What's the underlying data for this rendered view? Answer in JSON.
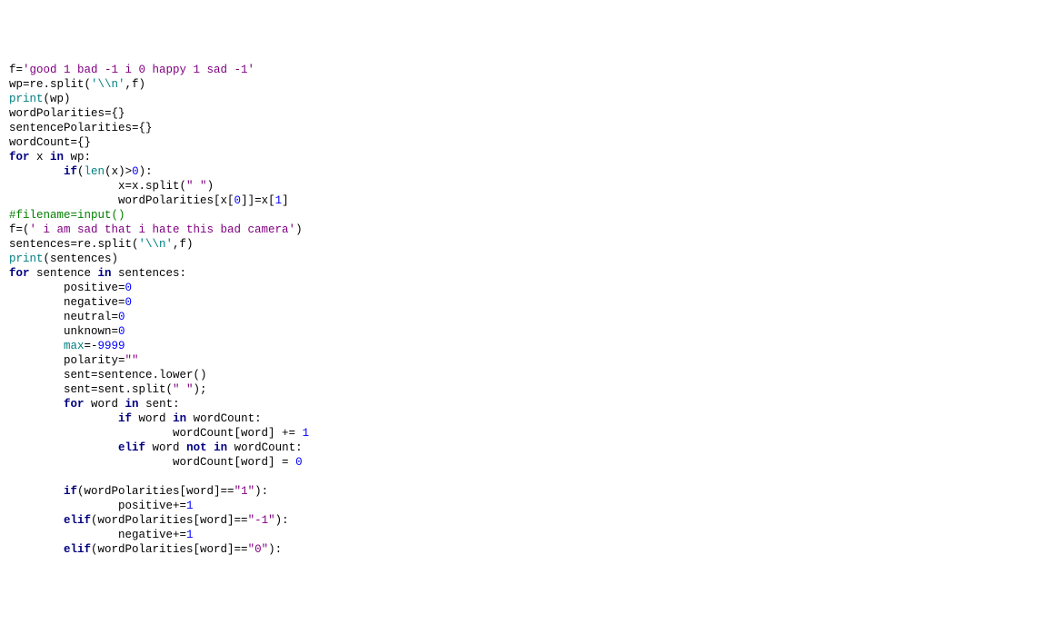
{
  "code": {
    "line1_a": "f=",
    "line1_b": "'good 1 bad -1 i 0 happy 1 sad -1'",
    "line2_a": "wp=re.split(",
    "line2_b": "'\\\\n'",
    "line2_c": ",f)",
    "line3_a": "print",
    "line3_b": "(wp)",
    "line4": "wordPolarities={}",
    "line5": "sentencePolarities={}",
    "line6": "wordCount={}",
    "line7_a": "for",
    "line7_b": " x ",
    "line7_c": "in",
    "line7_d": " wp:",
    "line8_a": "        ",
    "line8_b": "if",
    "line8_c": "(",
    "line8_d": "len",
    "line8_e": "(x)>",
    "line8_f": "0",
    "line8_g": "):",
    "line9_a": "                x=x.split(",
    "line9_b": "\" \"",
    "line9_c": ")",
    "line10_a": "                wordPolarities[x[",
    "line10_b": "0",
    "line10_c": "]]=x[",
    "line10_d": "1",
    "line10_e": "]",
    "line11": "#filename=input()",
    "line12_a": "f=(",
    "line12_b": "' i am sad that i hate this bad camera'",
    "line12_c": ")",
    "line13_a": "sentences=re.split(",
    "line13_b": "'\\\\n'",
    "line13_c": ",f)",
    "line14_a": "print",
    "line14_b": "(sentences)",
    "line15_a": "for",
    "line15_b": " sentence ",
    "line15_c": "in",
    "line15_d": " sentences:",
    "line16_a": "        positive=",
    "line16_b": "0",
    "line17_a": "        negative=",
    "line17_b": "0",
    "line18_a": "        neutral=",
    "line18_b": "0",
    "line19_a": "        unknown=",
    "line19_b": "0",
    "line20_a": "        ",
    "line20_b": "max",
    "line20_c": "=-",
    "line20_d": "9999",
    "line21_a": "        polarity=",
    "line21_b": "\"\"",
    "line22": "        sent=sentence.lower()",
    "line23_a": "        sent=sent.split(",
    "line23_b": "\" \"",
    "line23_c": ");",
    "line24_a": "        ",
    "line24_b": "for",
    "line24_c": " word ",
    "line24_d": "in",
    "line24_e": " sent:",
    "line25_a": "                ",
    "line25_b": "if",
    "line25_c": " word ",
    "line25_d": "in",
    "line25_e": " wordCount:",
    "line26_a": "                        wordCount[word] += ",
    "line26_b": "1",
    "line27_a": "                ",
    "line27_b": "elif",
    "line27_c": " word ",
    "line27_d": "not",
    "line27_e": " ",
    "line27_f": "in",
    "line27_g": " wordCount:",
    "line28_a": "                        wordCount[word] = ",
    "line28_b": "0",
    "line29": "",
    "line30_a": "        ",
    "line30_b": "if",
    "line30_c": "(wordPolarities[word]==",
    "line30_d": "\"1\"",
    "line30_e": "):",
    "line31_a": "                positive+=",
    "line31_b": "1",
    "line32_a": "        ",
    "line32_b": "elif",
    "line32_c": "(wordPolarities[word]==",
    "line32_d": "\"-1\"",
    "line32_e": "):",
    "line33_a": "                negative+=",
    "line33_b": "1",
    "line34_a": "        ",
    "line34_b": "elif",
    "line34_c": "(wordPolarities[word]==",
    "line34_d": "\"0\"",
    "line34_e": "):"
  }
}
